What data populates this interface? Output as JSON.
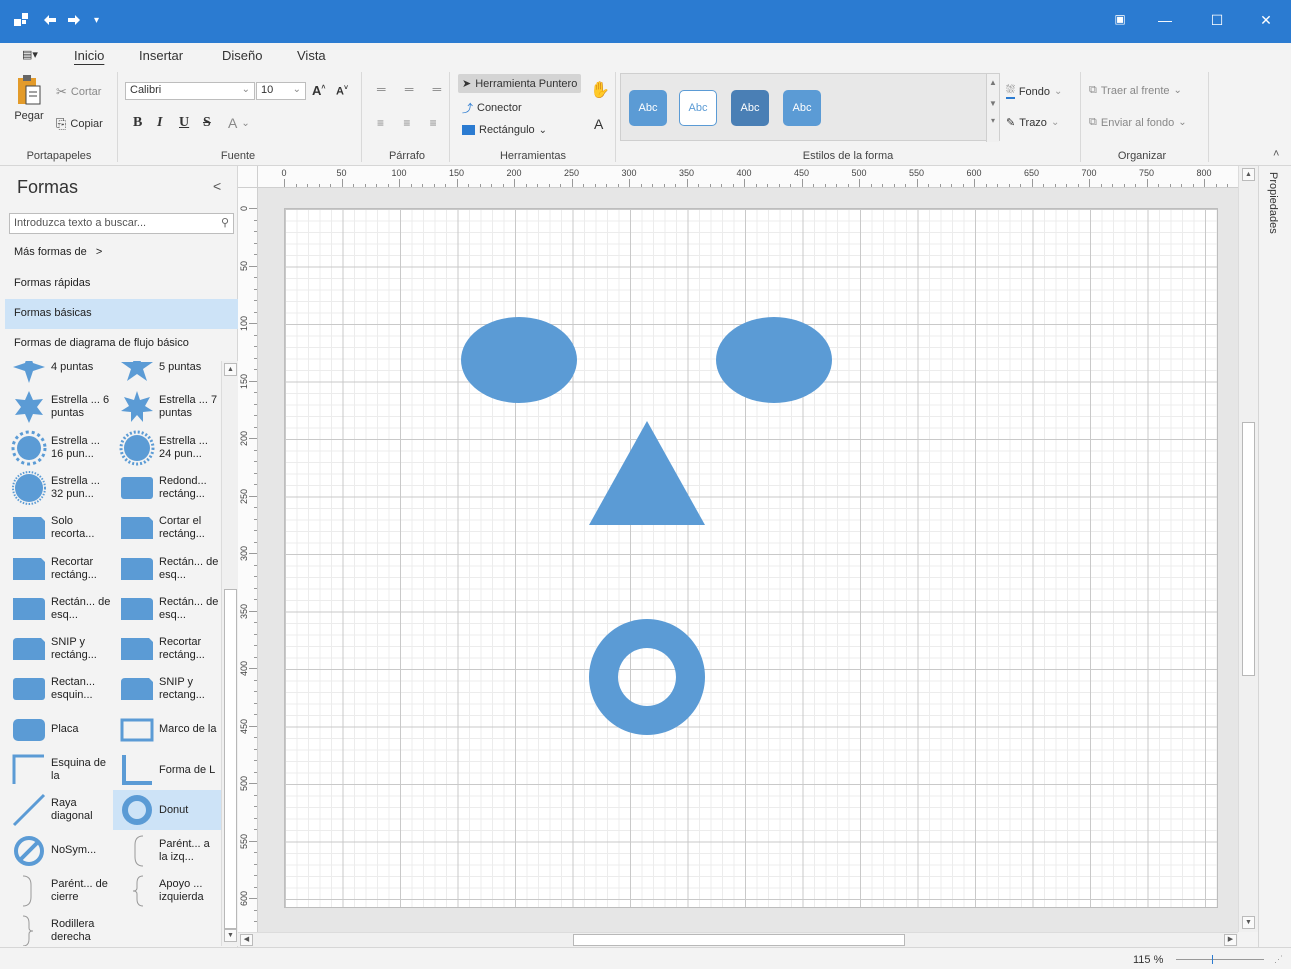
{
  "window": {
    "quick_access": [
      "app-icon",
      "undo-icon",
      "redo-icon",
      "customize-icon"
    ],
    "controls": [
      "ribbon-display-icon",
      "minimize-icon",
      "maximize-icon",
      "close-icon"
    ]
  },
  "ribbon": {
    "tabs": [
      "Inicio",
      "Insertar",
      "Diseño",
      "Vista"
    ],
    "active_tab": "Inicio",
    "clipboard": {
      "paste": "Pegar",
      "cut": "Cortar",
      "copy": "Copiar",
      "label": "Portapapeles"
    },
    "font": {
      "family": "Calibri",
      "size": "10",
      "bold": "B",
      "italic": "I",
      "underline": "U",
      "strike": "S",
      "color": "A",
      "label": "Fuente"
    },
    "paragraph": {
      "label": "Párrafo"
    },
    "tools": {
      "pointer": "Herramienta Puntero",
      "connector": "Conector",
      "rectangle": "Rectángulo",
      "label": "Herramientas",
      "text_tool": "A"
    },
    "styles": {
      "swatch": "Abc",
      "label": "Estilos de la forma",
      "fill": "Fondo",
      "stroke": "Trazo",
      "colors": [
        "#5b9bd5",
        "#ffffff",
        "#4a7fb5",
        "#5b9bd5"
      ]
    },
    "arrange": {
      "front": "Traer al frente",
      "back": "Enviar al fondo",
      "label": "Organizar"
    }
  },
  "shapes_panel": {
    "title": "Formas",
    "search_placeholder": "Introduzca texto a buscar...",
    "more_shapes": "Más formas de",
    "categories": [
      "Formas rápidas",
      "Formas básicas",
      "Formas de diagrama de flujo básico"
    ],
    "selected_category": "Formas básicas",
    "items": [
      {
        "label": "4 puntas",
        "icon": "star-4-icon"
      },
      {
        "label": "5 puntas",
        "icon": "star-5-icon"
      },
      {
        "label": "Estrella ... 6 puntas",
        "icon": "star-6-icon"
      },
      {
        "label": "Estrella ... 7 puntas",
        "icon": "star-7-icon"
      },
      {
        "label": "Estrella ... 16 pun...",
        "icon": "star-16-icon"
      },
      {
        "label": "Estrella ... 24 pun...",
        "icon": "star-24-icon"
      },
      {
        "label": "Estrella ... 32 pun...",
        "icon": "star-32-icon"
      },
      {
        "label": "Redond... rectáng...",
        "icon": "round-rect-icon"
      },
      {
        "label": "Solo recorta...",
        "icon": "snip-rect-icon"
      },
      {
        "label": "Cortar el rectáng...",
        "icon": "snip-rect-icon"
      },
      {
        "label": "Recortar rectáng...",
        "icon": "snip-rect-icon"
      },
      {
        "label": "Rectán... de esq...",
        "icon": "round-corner-rect-icon"
      },
      {
        "label": "Rectán... de esq...",
        "icon": "round-corner-rect-icon"
      },
      {
        "label": "Rectán... de esq...",
        "icon": "round-corner-rect-icon"
      },
      {
        "label": "SNIP y rectáng...",
        "icon": "snip-round-rect-icon"
      },
      {
        "label": "Recortar rectáng...",
        "icon": "snip-rect-icon"
      },
      {
        "label": "Rectan... esquin...",
        "icon": "round-rect-icon"
      },
      {
        "label": "SNIP y rectang...",
        "icon": "snip-round-rect-icon"
      },
      {
        "label": "Placa",
        "icon": "plaque-icon"
      },
      {
        "label": "Marco de la",
        "icon": "frame-icon"
      },
      {
        "label": "Esquina de la",
        "icon": "corner-icon"
      },
      {
        "label": "Forma de L",
        "icon": "l-shape-icon"
      },
      {
        "label": "Raya diagonal",
        "icon": "diagonal-stripe-icon"
      },
      {
        "label": "Donut",
        "icon": "donut-icon"
      },
      {
        "label": "NoSym...",
        "icon": "no-symbol-icon"
      },
      {
        "label": "Parént... a la izq...",
        "icon": "left-bracket-icon"
      },
      {
        "label": "Parént... de cierre",
        "icon": "right-bracket-icon"
      },
      {
        "label": "Apoyo ... izquierda",
        "icon": "left-brace-icon"
      },
      {
        "label": "Rodillera derecha",
        "icon": "right-brace-icon"
      }
    ],
    "selected_item": "Donut"
  },
  "ruler": {
    "top": [
      "0",
      "50",
      "100",
      "150",
      "200",
      "250",
      "300",
      "350",
      "400",
      "450",
      "500",
      "550",
      "600",
      "650",
      "700",
      "750",
      "800"
    ],
    "left": [
      "0",
      "50",
      "100",
      "150",
      "200",
      "250",
      "300",
      "350",
      "400",
      "450",
      "500",
      "550",
      "600"
    ]
  },
  "canvas": {
    "shape_color": "#5b9bd5",
    "shapes": [
      "ellipse",
      "ellipse",
      "triangle",
      "donut"
    ]
  },
  "properties_panel": {
    "label": "Propiedades"
  },
  "status": {
    "zoom": "115 %"
  }
}
